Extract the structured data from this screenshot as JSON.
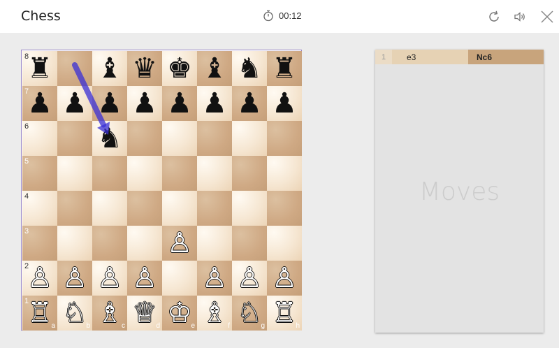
{
  "app": {
    "title": "Chess"
  },
  "timer": {
    "value": "00:12",
    "icon": "stopwatch-icon"
  },
  "toolbar": {
    "icons": [
      "restart-icon",
      "sound-icon",
      "close-icon"
    ]
  },
  "board": {
    "files": [
      "a",
      "b",
      "c",
      "d",
      "e",
      "f",
      "g",
      "h"
    ],
    "ranks": [
      "8",
      "7",
      "6",
      "5",
      "4",
      "3",
      "2",
      "1"
    ],
    "position": [
      [
        "♜",
        "",
        "♝",
        "♛",
        "♚",
        "♝",
        "♞",
        "♜"
      ],
      [
        "♟",
        "♟",
        "♟",
        "♟",
        "♟",
        "♟",
        "♟",
        "♟"
      ],
      [
        "",
        "",
        "♞",
        "",
        "",
        "",
        "",
        ""
      ],
      [
        "",
        "",
        "",
        "",
        "",
        "",
        "",
        ""
      ],
      [
        "",
        "",
        "",
        "",
        "",
        "",
        "",
        ""
      ],
      [
        "",
        "",
        "",
        "",
        "♙",
        "",
        "",
        ""
      ],
      [
        "♙",
        "♙",
        "♙",
        "♙",
        "",
        "♙",
        "♙",
        "♙"
      ],
      [
        "♖",
        "♘",
        "♗",
        "♕",
        "♔",
        "♗",
        "♘",
        "♖"
      ]
    ],
    "last_move_arrow": {
      "from": "b8",
      "to": "c6",
      "color": "#3a2fd6"
    },
    "colors": {
      "frame": "#9a86c8"
    }
  },
  "moves": {
    "watermark": "Moves",
    "rows": [
      {
        "num": "1",
        "white": "e3",
        "black": "Nc6"
      }
    ]
  }
}
